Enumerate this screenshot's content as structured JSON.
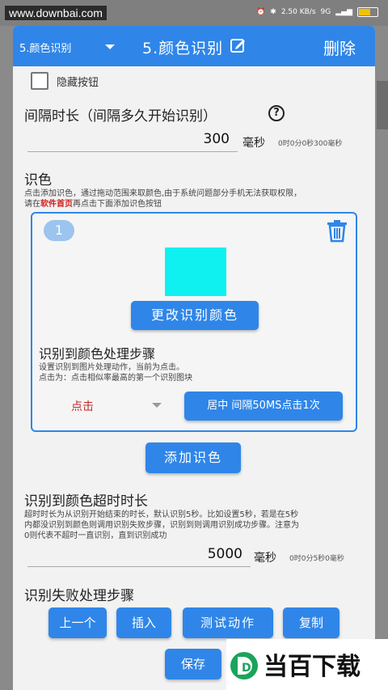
{
  "status": {
    "url_watermark": "www.downbai.com",
    "net_speed": "2.50 KB/s",
    "net_type": "9G"
  },
  "titlebar": {
    "selector_value": "5.颜色识别",
    "title": "5.颜色识别",
    "delete_label": "删除"
  },
  "hide_button": {
    "label": "隐藏按钮",
    "checked": false
  },
  "interval": {
    "title": "间隔时长（间隔多久开始识别）",
    "help": "?",
    "value": "300",
    "unit": "毫秒",
    "hint": "0时0分0秒300毫秒"
  },
  "color_recog": {
    "title": "识色",
    "desc_1": "点击添加识色，通过拖动范围来取颜色,由于系统问题部分手机无法获取权限，",
    "desc_2_prefix": "请在",
    "desc_2_link": "软件首页",
    "desc_2_suffix": "再点击下面添加识色按钮"
  },
  "color_card": {
    "index": "1",
    "swatch_color": "#0ff0f0",
    "change_color_label": "更改识别颜色",
    "step_title": "识别到颜色处理步骤",
    "step_desc_1": "设置识别到图片处理动作，当前为点击。",
    "step_desc_2": "点击为：点击相似率最高的第一个识别图块",
    "action_value": "点击",
    "action_detail_label": "居中 间隔50MS点击1次"
  },
  "add_color_label": "添加识色",
  "timeout": {
    "title": "识别到颜色超时时长",
    "desc_1": "超时时长为从识别开始结束的时长，默认识别5秒。比如设置5秒，若是在5秒",
    "desc_2": "内都没识别到颜色则调用识别失败步骤，识别到则调用识别成功步骤。注意为",
    "desc_3": "0则代表不超时一直识别，直到识别成功",
    "value": "5000",
    "unit": "毫秒",
    "hint": "0时0分5秒0毫秒"
  },
  "fail": {
    "title": "识别失败处理步骤",
    "prev_label": "上一个",
    "insert_label": "插入",
    "test_label": "测试动作",
    "copy_label": "复制",
    "save_label": "保存"
  },
  "logo": {
    "text": "当百下载",
    "mark": "D"
  },
  "colors": {
    "accent": "#2f86e8",
    "link_red": "#d21d1d"
  }
}
